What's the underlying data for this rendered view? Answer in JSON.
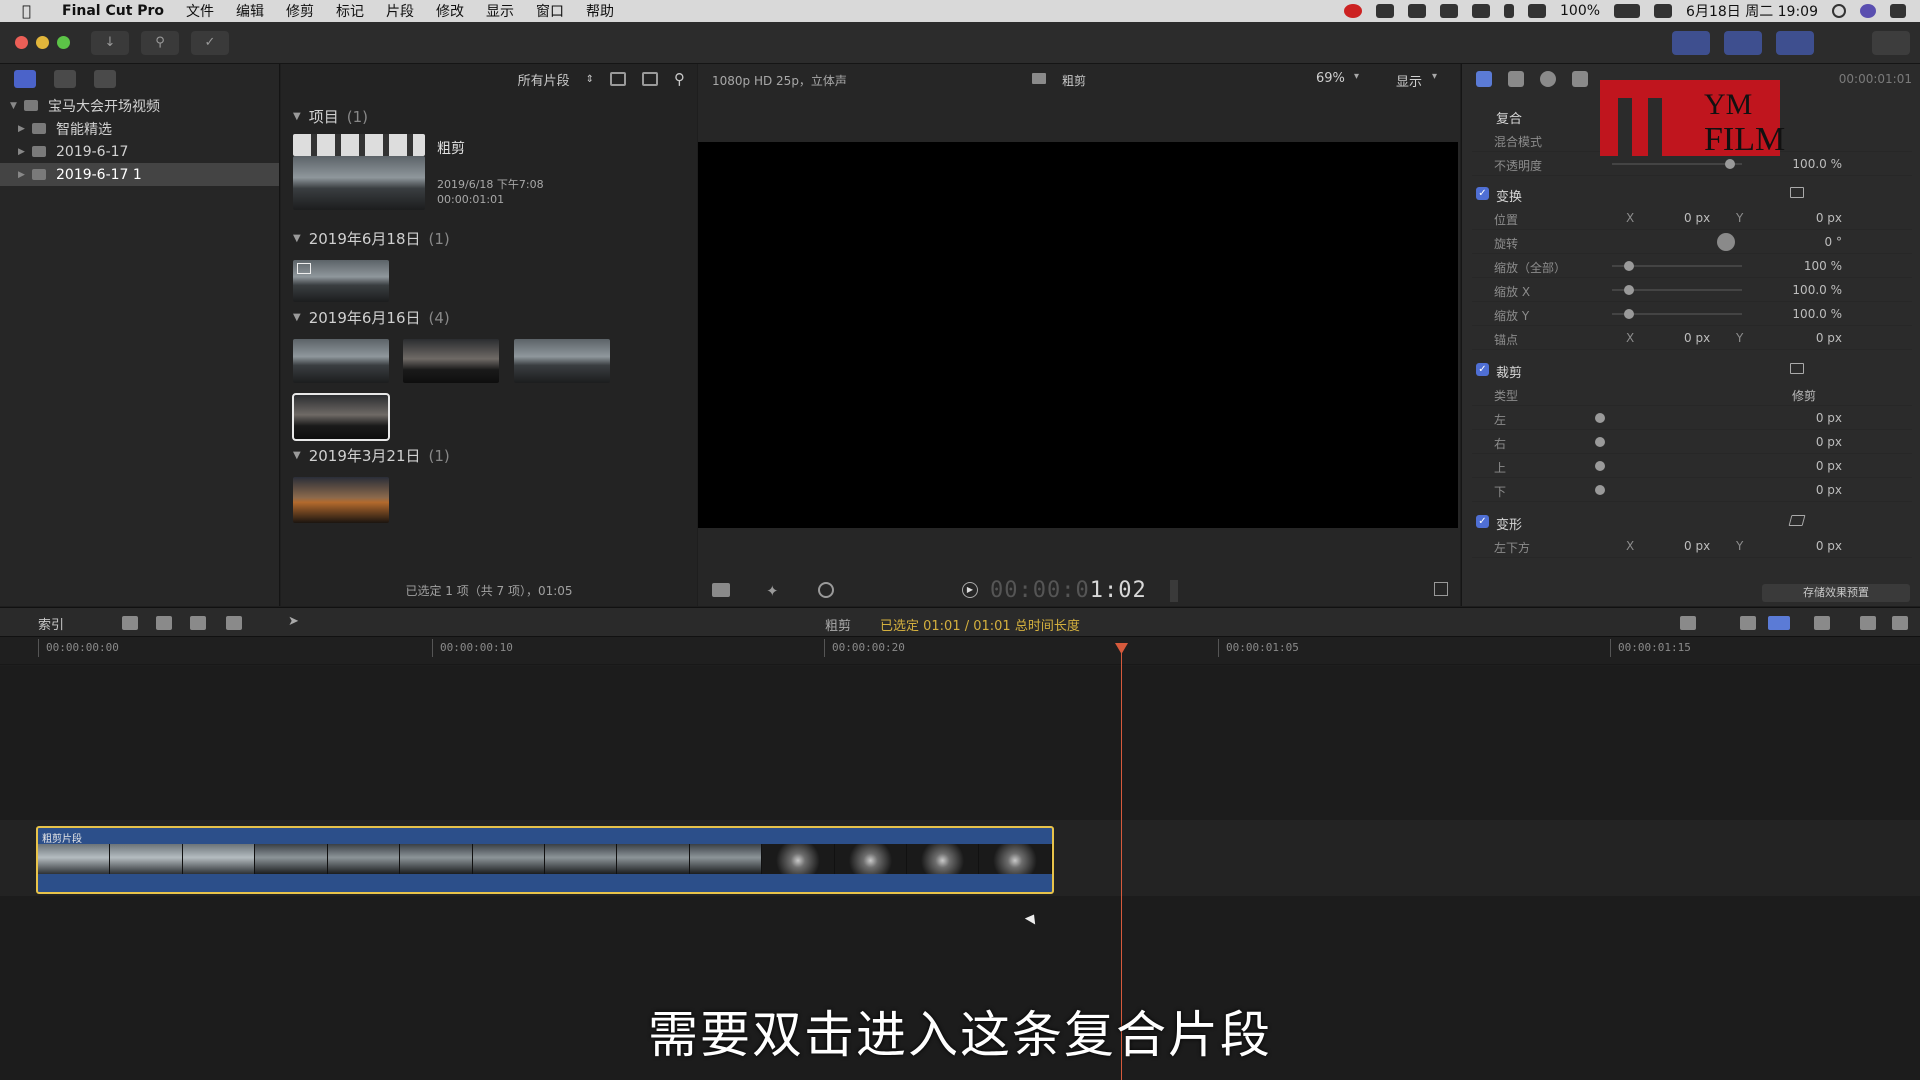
{
  "menubar": {
    "app_name": "Final Cut Pro",
    "items": [
      "文件",
      "编辑",
      "修剪",
      "标记",
      "片段",
      "修改",
      "显示",
      "窗口",
      "帮助"
    ],
    "battery": "100%",
    "datetime": "6月18日 周二  19:09"
  },
  "libraries": {
    "library_name": "宝马大会开场视频",
    "items": [
      {
        "label": "智能精选"
      },
      {
        "label": "2019-6-17"
      },
      {
        "label": "2019-6-17 1"
      }
    ]
  },
  "browser": {
    "filter_label": "所有片段",
    "project_section": {
      "title": "项目",
      "count": "(1)"
    },
    "project": {
      "name": "粗剪",
      "date": "2019/6/18 下午7:08",
      "duration": "00:00:01:01"
    },
    "sections": [
      {
        "title": "2019年6月18日",
        "count": "(1)"
      },
      {
        "title": "2019年6月16日",
        "count": "(4)"
      },
      {
        "title": "2019年3月21日",
        "count": "(1)"
      }
    ],
    "status": "已选定 1 项（共 7 项），01:05"
  },
  "viewer": {
    "format": "1080p HD 25p，立体声",
    "project_name": "粗剪",
    "zoom": "69%",
    "display_label": "显示",
    "timecode_dim": "00:00:0",
    "timecode_bright": "1:02"
  },
  "inspector": {
    "header_timecode": "00:00:01:01",
    "composite": "复合",
    "blend_mode": "混合模式",
    "opacity": {
      "label": "不透明度",
      "value": "100.0 %"
    },
    "transform": {
      "label": "变换"
    },
    "position": {
      "label": "位置",
      "x": "0 px",
      "y": "0 px"
    },
    "rotation": {
      "label": "旋转",
      "value": "0 °"
    },
    "scale_all": {
      "label": "缩放（全部）",
      "value": "100 %"
    },
    "scale_x": {
      "label": "缩放 X",
      "value": "100.0 %"
    },
    "scale_y": {
      "label": "缩放 Y",
      "value": "100.0 %"
    },
    "anchor": {
      "label": "锚点",
      "x": "0 px",
      "y": "0 px"
    },
    "crop": {
      "label": "裁剪"
    },
    "crop_type": {
      "label": "类型",
      "value": "修剪"
    },
    "crop_left": {
      "label": "左",
      "value": "0 px"
    },
    "crop_right": {
      "label": "右",
      "value": "0 px"
    },
    "crop_top": {
      "label": "上",
      "value": "0 px"
    },
    "crop_bottom": {
      "label": "下",
      "value": "0 px"
    },
    "distort": {
      "label": "变形"
    },
    "bottom_left": {
      "label": "左下方",
      "x": "0 px",
      "y": "0 px"
    },
    "axis_x": "X",
    "axis_y": "Y",
    "save_preset": "存储效果预置"
  },
  "logo": {
    "text": "YM FILM"
  },
  "timeline": {
    "index_label": "索引",
    "project_name": "粗剪",
    "selection_info": "已选定 01:01 / 01:01 总时间长度",
    "ruler": [
      "00:00:00:00",
      "00:00:00:10",
      "00:00:00:20",
      "00:00:01:05",
      "00:00:01:15"
    ],
    "clip_label": "粗剪片段"
  },
  "subtitle": "需要双击进入这条复合片段",
  "colors": {
    "accent": "#4f6fd4",
    "clip": "#2c4f8a",
    "clip_border": "#e8c34a",
    "playhead": "#d65a3c",
    "logo": "#c8141e"
  }
}
